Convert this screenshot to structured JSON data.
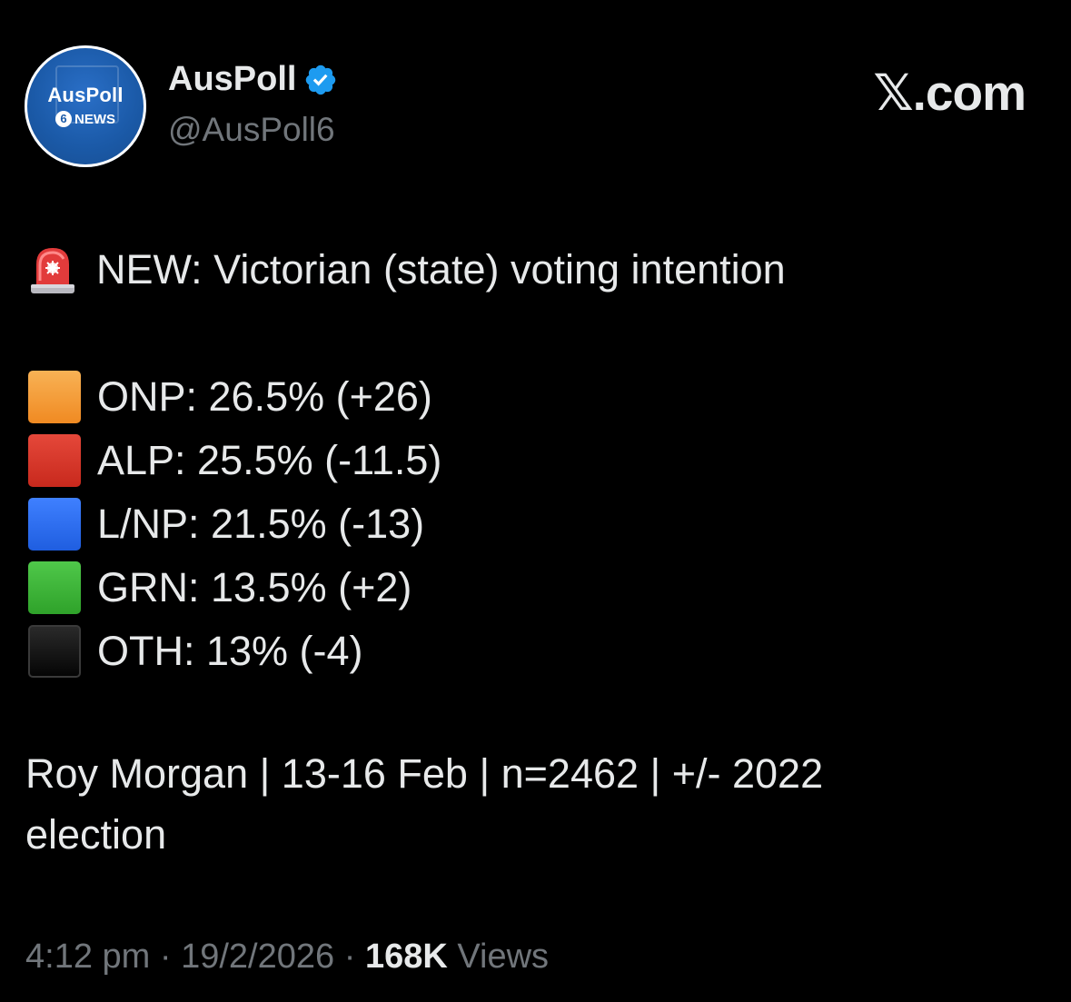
{
  "author": {
    "avatar_text": "AusPoll",
    "avatar_sub_number": "6",
    "avatar_sub_text": "NEWS",
    "display_name": "AusPoll",
    "handle": "@AusPoll6",
    "verified_icon": "verified-badge-icon",
    "verified_color": "#1d9bf0"
  },
  "source": {
    "label": "𝕏.com"
  },
  "tweet": {
    "headline": "NEW: Victorian (state) voting intention",
    "headline_icon": "police-light-icon",
    "results": [
      {
        "text": "ONP: 26.5% (+26)",
        "color": "#f6a03b"
      },
      {
        "text": "ALP: 25.5% (-11.5)",
        "color": "#d93a2b"
      },
      {
        "text": "L/NP: 21.5% (-13)",
        "color": "#2d6ff2"
      },
      {
        "text": "GRN: 13.5% (+2)",
        "color": "#3fb53a"
      },
      {
        "text": "OTH: 13% (-4)",
        "color": "#111111"
      }
    ],
    "footer_line1": "Roy Morgan | 13-16 Feb | n=2462 | +/- 2022",
    "footer_line2": "election"
  },
  "meta": {
    "time": "4:12 pm",
    "separator": " · ",
    "date": "19/2/2026",
    "views_count": "168K",
    "views_label": " Views"
  }
}
